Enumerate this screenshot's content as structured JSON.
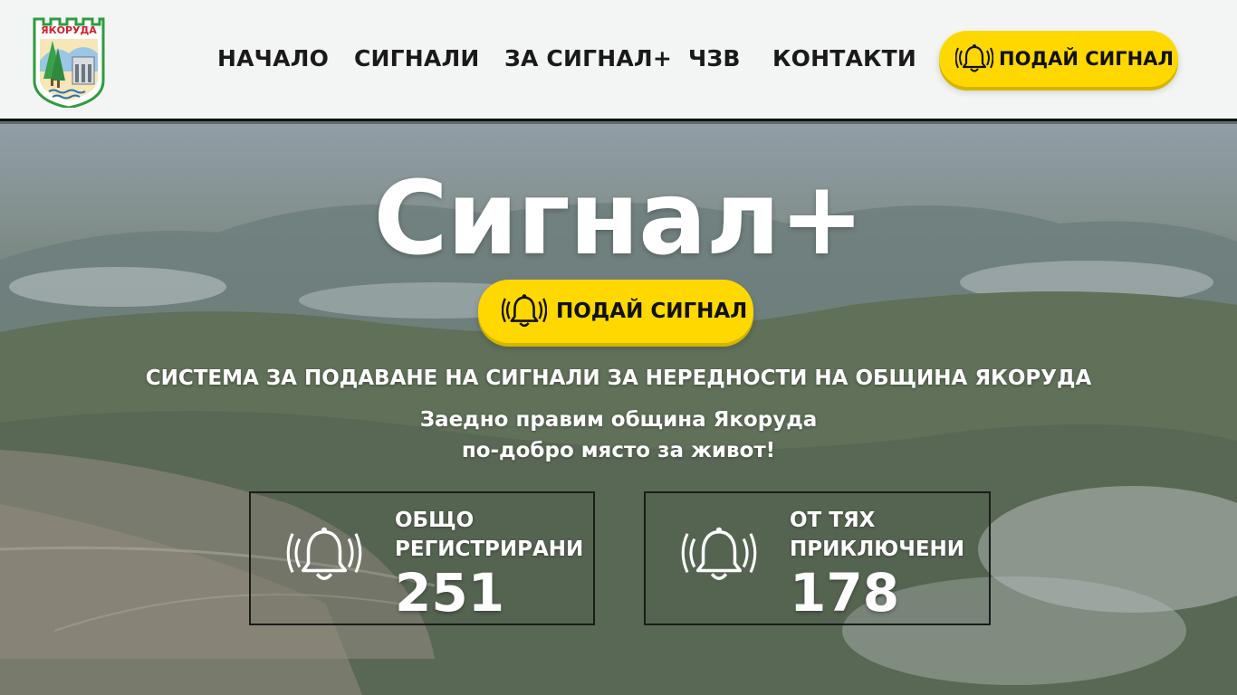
{
  "header": {
    "logo": {
      "text": "ЯКОРУДА"
    },
    "nav": [
      "НАЧАЛО",
      "СИГНАЛИ",
      "ЗА СИГНАЛ+",
      "ЧЗВ",
      "КОНТАКТИ"
    ],
    "cta_label": "ПОДАЙ СИГНАЛ"
  },
  "hero": {
    "title": "Сигнал+",
    "cta_label": "ПОДАЙ СИГНАЛ",
    "subtitle": "СИСТЕМА ЗА ПОДАВАНЕ НА СИГНАЛИ ЗА НЕРЕДНОСТИ НА ОБЩИНА ЯКОРУДА",
    "tagline_line1": "Заедно правим община Якоруда",
    "tagline_line2": "по-добро място за живот!"
  },
  "stats": [
    {
      "label_line1": "ОБЩО",
      "label_line2": "РЕГИСТРИРАНИ",
      "value": "251"
    },
    {
      "label_line1": "ОТ ТЯХ",
      "label_line2": "ПРИКЛЮЧЕНИ",
      "value": "178"
    }
  ],
  "colors": {
    "accent": "#ffd800",
    "header_bg": "#f2f5f3",
    "text_dark": "#1a1a1a",
    "text_light": "#ffffff"
  },
  "icons": [
    "municipal-crest-icon",
    "bell-ringing-icon"
  ]
}
